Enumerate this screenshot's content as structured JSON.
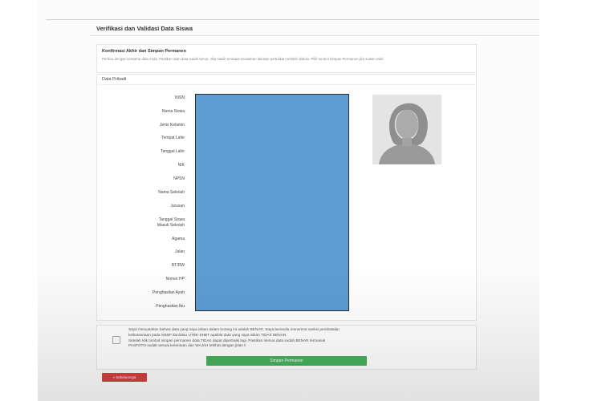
{
  "page": {
    "title": "Verifikasi dan Validasi Data Siswa"
  },
  "confirm": {
    "title": "Konfirmasi Akhir dan Simpan Permanen",
    "text": "Periksa dengan seksama data Anda. Pastikan isian data sudah benar. Jika masih terdapat kesalahan lakukan perbaikan terlebih dahulu. Pilih tombol Simpan Permanen jika sudah valid."
  },
  "data_panel": {
    "header": "Data Pribadi",
    "fields": [
      {
        "label": "NISN"
      },
      {
        "label": "Nama Siswa"
      },
      {
        "label": "Jenis Kelamin"
      },
      {
        "label": "Tempat Lahir"
      },
      {
        "label": "Tanggal Lahir"
      },
      {
        "label": "NIK"
      },
      {
        "label": "NPSN"
      },
      {
        "label": "Nama Sekolah"
      },
      {
        "label": "Jurusan"
      },
      {
        "label": "Tanggal Siswa"
      },
      {
        "label": "Masuk Sekolah"
      },
      {
        "label": "Agama"
      },
      {
        "label": "Jalan"
      },
      {
        "label": "RT/RW"
      },
      {
        "label": "Nomor HP"
      },
      {
        "label": "Penghasilan Ayah"
      },
      {
        "label": "Penghasilan Ibu"
      }
    ],
    "masked_color": "#5d9dd3",
    "photo_icon": "user-silhouette-icon"
  },
  "agreement": {
    "line1": "Saya menyatakan bahwa data yang saya isikan dalam borang ini adalah BENAR. Saya bersedia menerima sanksi pembatalan",
    "line2": "keikutsertaan pada SNBP dan/atau UTBK-SNBT apabila data yang saya isikan TIDAK BENAR.",
    "line3": "Setelah klik tombol simpan permanen data TIDAK dapat diperbaiki lagi. Pastikan semua data sudah BENAR termasuk",
    "line4": "PASFOTO sudah sesuai ketentuan dan WAJAH terlihat dengan jelas !!"
  },
  "buttons": {
    "save_label": "Simpan Permanen",
    "back_label": "« Sebelumnya",
    "save_color": "#47b05c",
    "back_color": "#d2403f"
  }
}
